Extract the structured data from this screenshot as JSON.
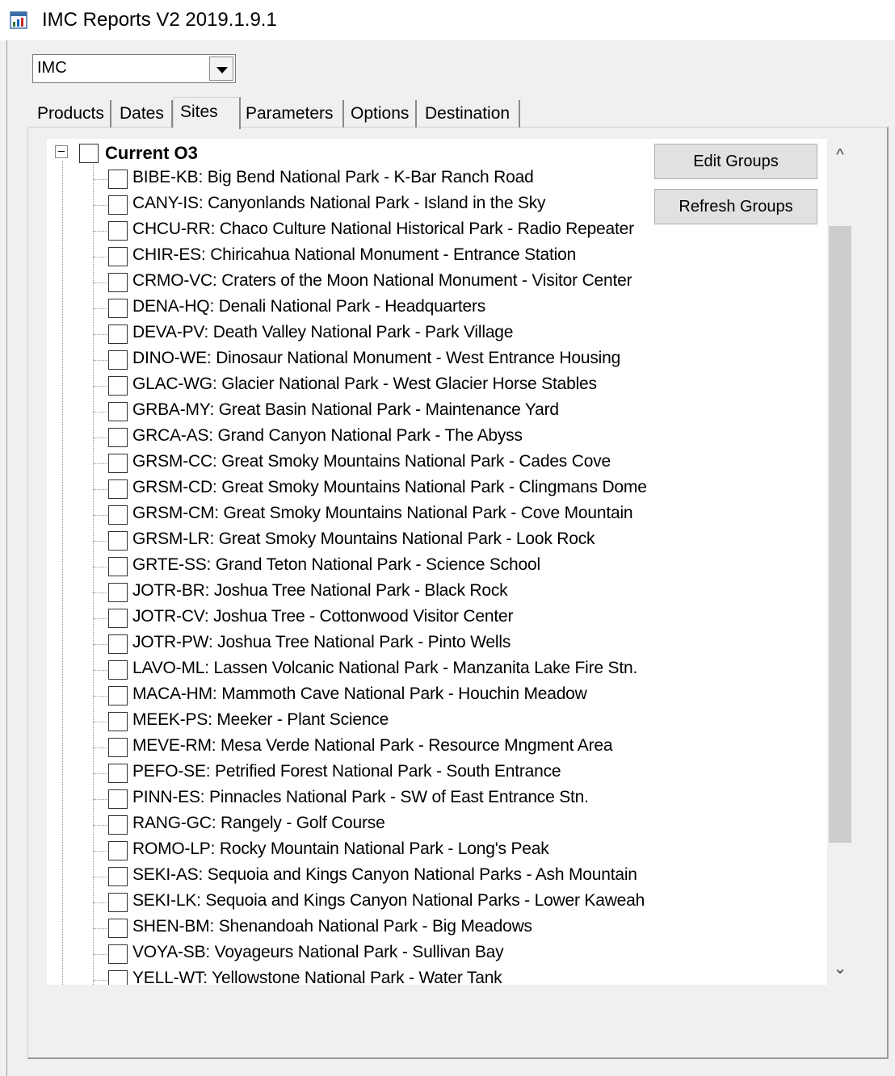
{
  "window": {
    "title": "IMC Reports V2 2019.1.9.1"
  },
  "dataset_select": {
    "value": "IMC"
  },
  "tabs": [
    {
      "label": "Products"
    },
    {
      "label": "Dates"
    },
    {
      "label": "Sites",
      "active": true
    },
    {
      "label": "Parameters"
    },
    {
      "label": "Options"
    },
    {
      "label": "Destination"
    }
  ],
  "buttons": {
    "edit_groups": "Edit Groups",
    "refresh_groups": "Refresh Groups"
  },
  "tree": {
    "root": {
      "label": "Current O3",
      "checked": false,
      "expanded": true
    },
    "items": [
      "BIBE-KB: Big Bend National Park - K-Bar Ranch Road",
      "CANY-IS: Canyonlands National Park - Island in the Sky",
      "CHCU-RR: Chaco Culture National Historical Park - Radio Repeater",
      "CHIR-ES: Chiricahua National Monument - Entrance Station",
      "CRMO-VC: Craters of the Moon National Monument - Visitor Center",
      "DENA-HQ: Denali National Park - Headquarters",
      "DEVA-PV: Death Valley National Park - Park Village",
      "DINO-WE: Dinosaur National Monument - West Entrance Housing",
      "GLAC-WG: Glacier National Park - West Glacier Horse Stables",
      "GRBA-MY: Great Basin National Park - Maintenance Yard",
      "GRCA-AS: Grand Canyon National Park - The Abyss",
      "GRSM-CC: Great Smoky Mountains National Park - Cades Cove",
      "GRSM-CD: Great Smoky Mountains National Park - Clingmans Dome",
      "GRSM-CM: Great Smoky Mountains National Park - Cove Mountain",
      "GRSM-LR: Great Smoky Mountains National Park - Look Rock",
      "GRTE-SS: Grand Teton National Park  - Science School",
      "JOTR-BR: Joshua Tree National Park - Black Rock",
      "JOTR-CV: Joshua Tree - Cottonwood Visitor Center",
      "JOTR-PW: Joshua Tree National Park - Pinto Wells",
      "LAVO-ML: Lassen Volcanic National Park - Manzanita Lake Fire Stn.",
      "MACA-HM: Mammoth Cave National Park - Houchin Meadow",
      "MEEK-PS: Meeker - Plant Science",
      "MEVE-RM: Mesa Verde National Park - Resource Mngment Area",
      "PEFO-SE: Petrified Forest National Park - South Entrance",
      "PINN-ES: Pinnacles National Park - SW of East Entrance Stn.",
      "RANG-GC: Rangely - Golf Course",
      "ROMO-LP: Rocky Mountain National Park - Long's Peak",
      "SEKI-AS: Sequoia and Kings Canyon National Parks - Ash Mountain",
      "SEKI-LK: Sequoia and Kings Canyon National Parks - Lower Kaweah",
      "SHEN-BM: Shenandoah National Park - Big Meadows",
      "VOYA-SB: Voyageurs National Park - Sullivan Bay",
      "YELL-WT: Yellowstone National Park - Water Tank"
    ]
  },
  "scrollbar": {
    "up_glyph": "^",
    "down_glyph": "⌄"
  }
}
